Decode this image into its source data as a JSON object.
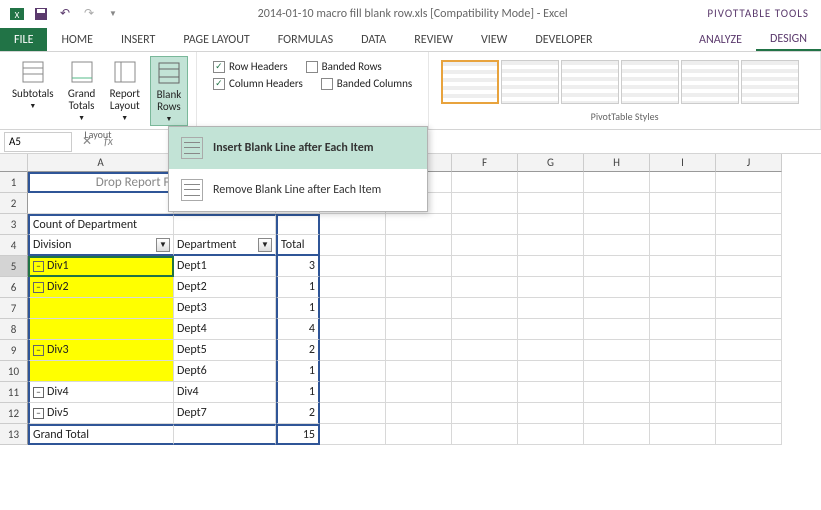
{
  "titlebar": {
    "title": "2014-01-10 macro fill blank row.xls  [Compatibility Mode] - Excel",
    "contextual": "PIVOTTABLE TOOLS"
  },
  "tabs": {
    "file": "FILE",
    "home": "HOME",
    "insert": "INSERT",
    "page_layout": "PAGE LAYOUT",
    "formulas": "FORMULAS",
    "data": "DATA",
    "review": "REVIEW",
    "view": "VIEW",
    "developer": "DEVELOPER",
    "analyze": "ANALYZE",
    "design": "DESIGN"
  },
  "ribbon": {
    "subtotals": "Subtotals",
    "grand_totals": "Grand\nTotals",
    "report_layout": "Report\nLayout",
    "blank_rows": "Blank\nRows",
    "layout_label": "Layout",
    "row_headers": "Row Headers",
    "column_headers": "Column Headers",
    "banded_rows": "Banded Rows",
    "banded_columns": "Banded Columns",
    "styles_label": "PivotTable Styles"
  },
  "dropdown": {
    "insert_blank": "Insert Blank Line after Each Item",
    "remove_blank": "Remove Blank Line after Each Item"
  },
  "namebox": "A5",
  "columns": [
    "A",
    "B",
    "C",
    "D",
    "E",
    "F",
    "G",
    "H",
    "I",
    "J"
  ],
  "drop_hint": "Drop Report Filter Fields Here",
  "pivot": {
    "count_label": "Count of Department",
    "division_header": "Division",
    "department_header": "Department",
    "total_header": "Total",
    "rows": [
      {
        "div": "Div1",
        "dept": "Dept1",
        "val": "3",
        "yellow": true,
        "exp": true
      },
      {
        "div": "Div2",
        "dept": "Dept2",
        "val": "1",
        "yellow": true,
        "exp": true
      },
      {
        "div": "",
        "dept": "Dept3",
        "val": "1",
        "yellow": true,
        "exp": false
      },
      {
        "div": "",
        "dept": "Dept4",
        "val": "4",
        "yellow": true,
        "exp": false
      },
      {
        "div": "Div3",
        "dept": "Dept5",
        "val": "2",
        "yellow": true,
        "exp": true
      },
      {
        "div": "",
        "dept": "Dept6",
        "val": "1",
        "yellow": true,
        "exp": false
      },
      {
        "div": "Div4",
        "dept": "Div4",
        "val": "1",
        "yellow": false,
        "exp": true
      },
      {
        "div": "Div5",
        "dept": "Dept7",
        "val": "2",
        "yellow": false,
        "exp": true
      }
    ],
    "grand_total_label": "Grand Total",
    "grand_total_val": "15"
  }
}
